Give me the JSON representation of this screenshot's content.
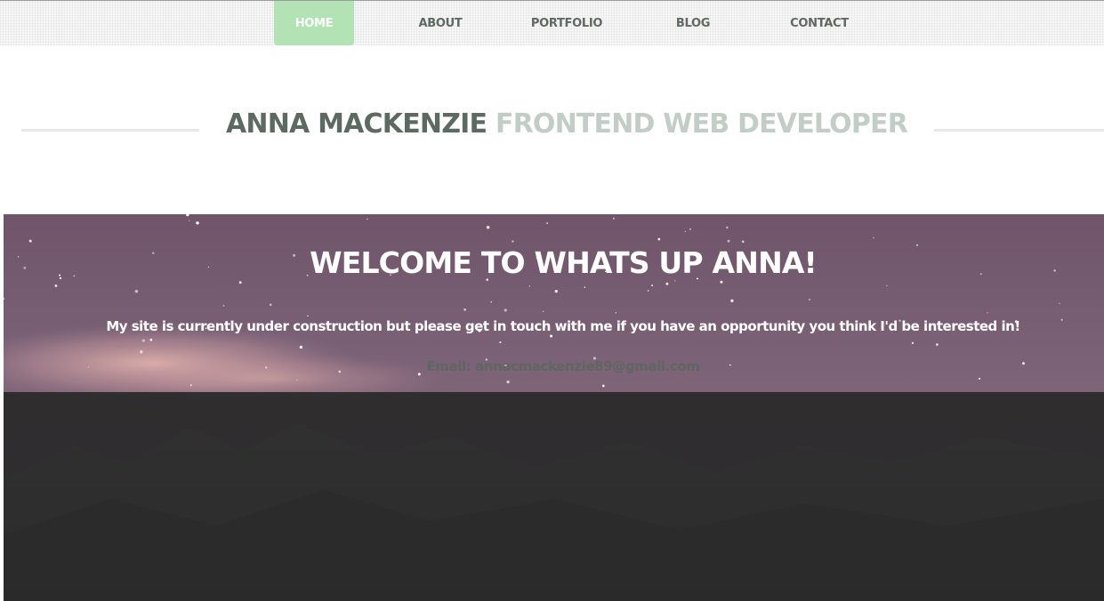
{
  "nav": {
    "items": [
      {
        "label": "HOME",
        "active": true
      },
      {
        "label": "ABOUT",
        "active": false
      },
      {
        "label": "PORTFOLIO",
        "active": false
      },
      {
        "label": "BLOG",
        "active": false
      },
      {
        "label": "CONTACT",
        "active": false
      }
    ],
    "active_color": "#b3e3b4"
  },
  "header": {
    "name": "ANNA MACKENZIE",
    "role": "FRONTEND WEB DEVELOPER",
    "name_color": "#5d6a62",
    "role_color": "#c3cdc8"
  },
  "hero": {
    "heading": "WELCOME TO WHATS UP ANNA!",
    "message": "My site is currently under construction but please get in touch with me if you have an opportunity you think I'd be interested in!",
    "email": "Email: annacmackenzie89@gmail.com"
  }
}
